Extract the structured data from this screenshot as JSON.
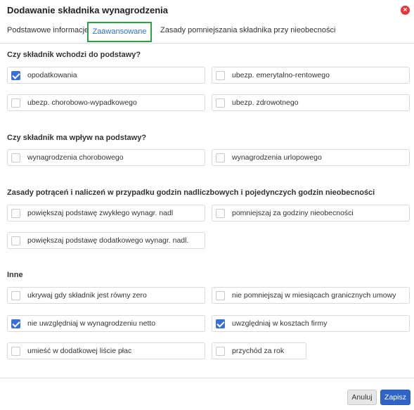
{
  "dialog": {
    "title": "Dodawanie składnika wynagrodzenia",
    "close_symbol": "×",
    "close_icon": "close-icon"
  },
  "tabs": [
    {
      "label": "Podstawowe informacje",
      "active": false
    },
    {
      "label": "Zaawansowane",
      "active": true
    },
    {
      "label": "Zasady pomniejszania składnika przy nieobecności",
      "active": false
    }
  ],
  "sections": {
    "basis": {
      "title": "Czy składnik wchodzi do podstawy?",
      "items": [
        {
          "label": "opodatkowania",
          "checked": true
        },
        {
          "label": "ubezp. emerytalno-rentowego",
          "checked": false
        },
        {
          "label": "ubezp. chorobowo-wypadkowego",
          "checked": false
        },
        {
          "label": "ubezp. zdrowotnego",
          "checked": false
        }
      ]
    },
    "influence": {
      "title": "Czy składnik ma wpływ na podstawy?",
      "items": [
        {
          "label": "wynagrodzenia chorobowego",
          "checked": false
        },
        {
          "label": "wynagrodzenia urlopowego",
          "checked": false
        }
      ]
    },
    "deductions": {
      "title": "Zasady potrąceń i naliczeń w przypadku godzin nadliczbowych i pojedynczych godzin nieobecności",
      "items": [
        {
          "label": "powiększaj podstawę zwykłego wynagr. nadl",
          "checked": false
        },
        {
          "label": "pomniejszaj za godziny nieobecności",
          "checked": false
        },
        {
          "label": "powiększaj podstawę dodatkowego wynagr. nadl.",
          "checked": false
        }
      ]
    },
    "other": {
      "title": "Inne",
      "items": [
        {
          "label": "ukrywaj gdy składnik jest równy zero",
          "checked": false
        },
        {
          "label": "nie pomniejszaj w miesiącach granicznych umowy",
          "checked": false
        },
        {
          "label": "nie uwzględniaj w wynagrodzeniu netto",
          "checked": true
        },
        {
          "label": "uwzględniaj w kosztach firmy",
          "checked": true
        },
        {
          "label": "umieść w dodatkowej liście płac",
          "checked": false
        },
        {
          "label": "przychód za rok",
          "checked": false
        }
      ]
    }
  },
  "footer": {
    "cancel_label": "Anuluj",
    "save_label": "Zapisz"
  },
  "colors": {
    "accent": "#3a6fd8",
    "active_tab_border": "#2ea043",
    "close_icon": "#e5383b"
  }
}
